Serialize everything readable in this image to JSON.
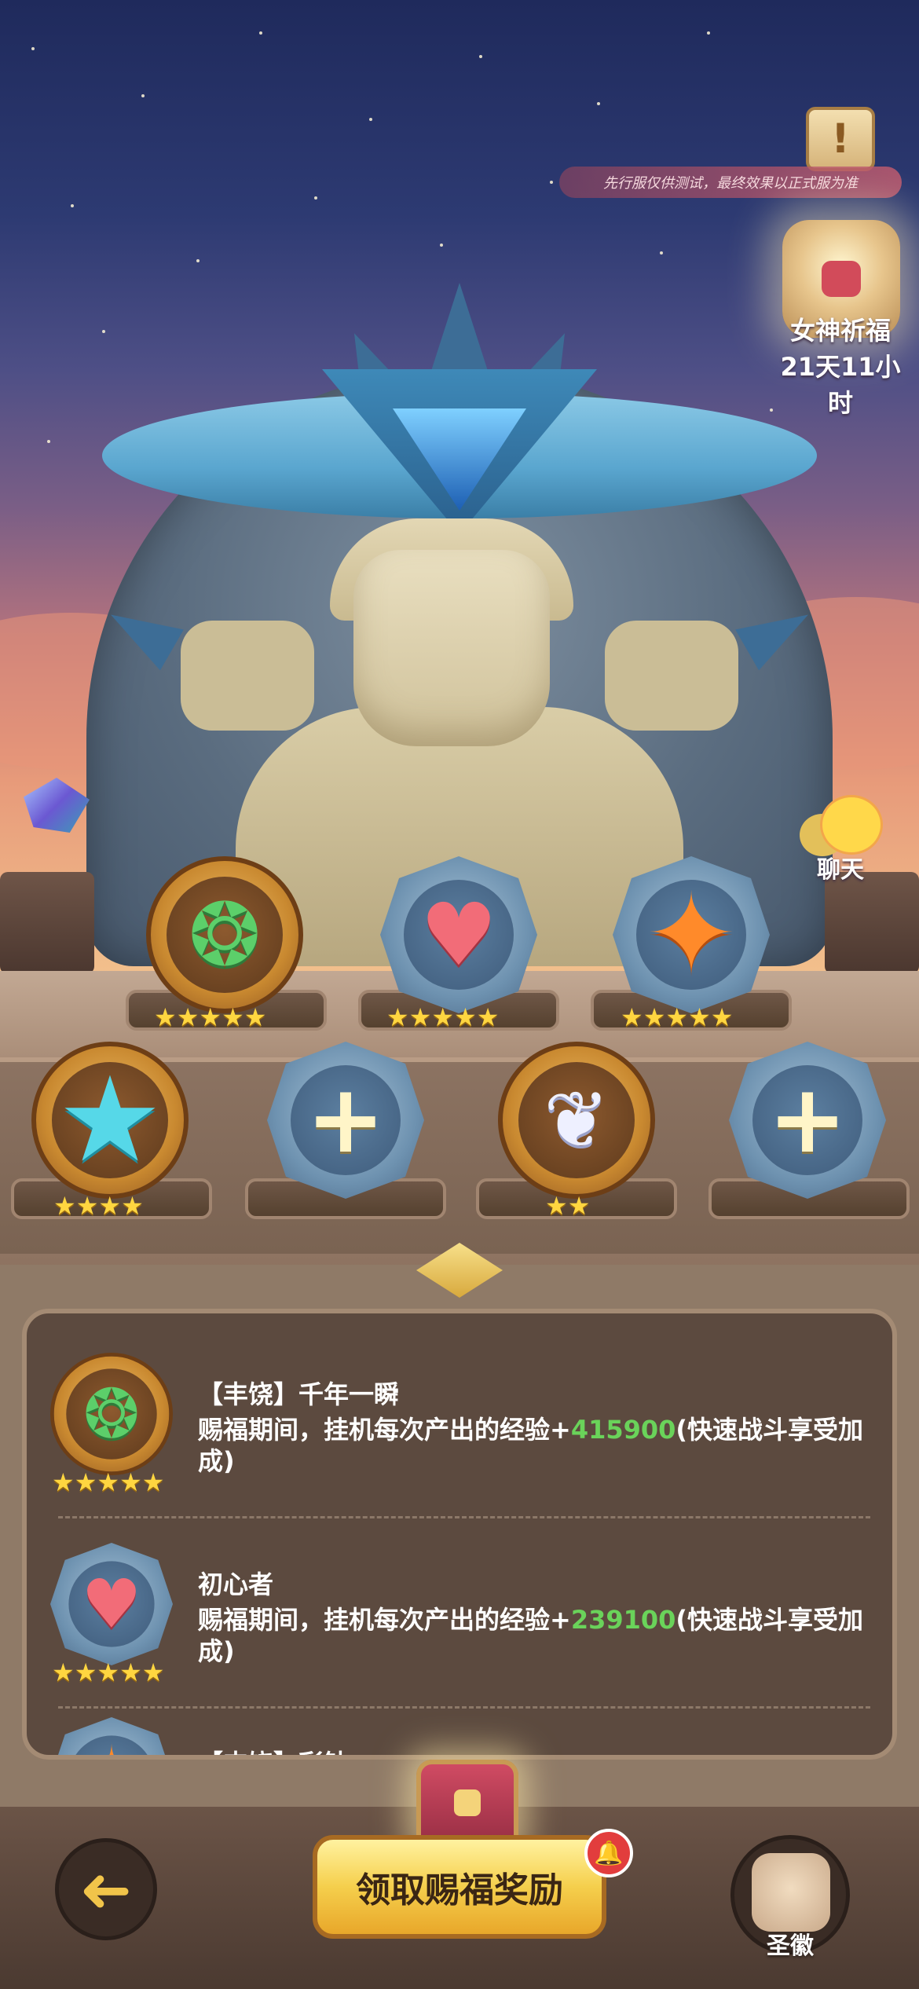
{
  "header": {
    "test_notice": "先行服仅供测试，最终效果以正式服为准",
    "notice_icon": "exclamation-scroll-icon"
  },
  "event": {
    "title": "女神祈福",
    "time_left": "21天11小时"
  },
  "chat": {
    "label": "聊天"
  },
  "slots_row1": [
    {
      "icon": "green-chameleon-icon",
      "glyph": "❂",
      "stars": "★★★★★",
      "frame": "gold"
    },
    {
      "icon": "heart-icon",
      "glyph": "♥",
      "stars": "★★★★★",
      "frame": "blue"
    },
    {
      "icon": "orange-diamond-star-icon",
      "glyph": "✦",
      "stars": "★★★★★",
      "frame": "blue"
    }
  ],
  "slots_row2": [
    {
      "icon": "cyan-star-icon",
      "glyph": "★",
      "stars": "★★★★",
      "frame": "gold"
    },
    {
      "icon": "add-slot-icon",
      "glyph": "+",
      "stars": "",
      "frame": "blue"
    },
    {
      "icon": "white-shell-icon",
      "glyph": "❦",
      "stars": "★★",
      "frame": "gold"
    },
    {
      "icon": "add-slot-icon",
      "glyph": "+",
      "stars": "",
      "frame": "blue"
    }
  ],
  "blessings": [
    {
      "title": "【丰饶】千年一瞬",
      "desc_prefix": "赐福期间，挂机每次产出的经验+",
      "value": "415900",
      "desc_suffix": "(快速战斗享受加成)",
      "stars": "★★★★★"
    },
    {
      "title": "初心者",
      "desc_prefix": "赐福期间，挂机每次产出的经验+",
      "value": "239100",
      "desc_suffix": "(快速战斗享受加成)",
      "stars": "★★★★★"
    },
    {
      "title": "【丰饶】彩钻",
      "desc_prefix": "",
      "value": "",
      "desc_suffix": "",
      "stars": ""
    }
  ],
  "footer": {
    "back_glyph": "➜",
    "claim_label": "领取赐福奖励",
    "bell_glyph": "🔔",
    "emblem_label": "圣徽"
  },
  "colors": {
    "highlight_green": "#6ad35a",
    "gold_button": "#f5cf4c",
    "panel_bg": "#5c4a3f"
  }
}
